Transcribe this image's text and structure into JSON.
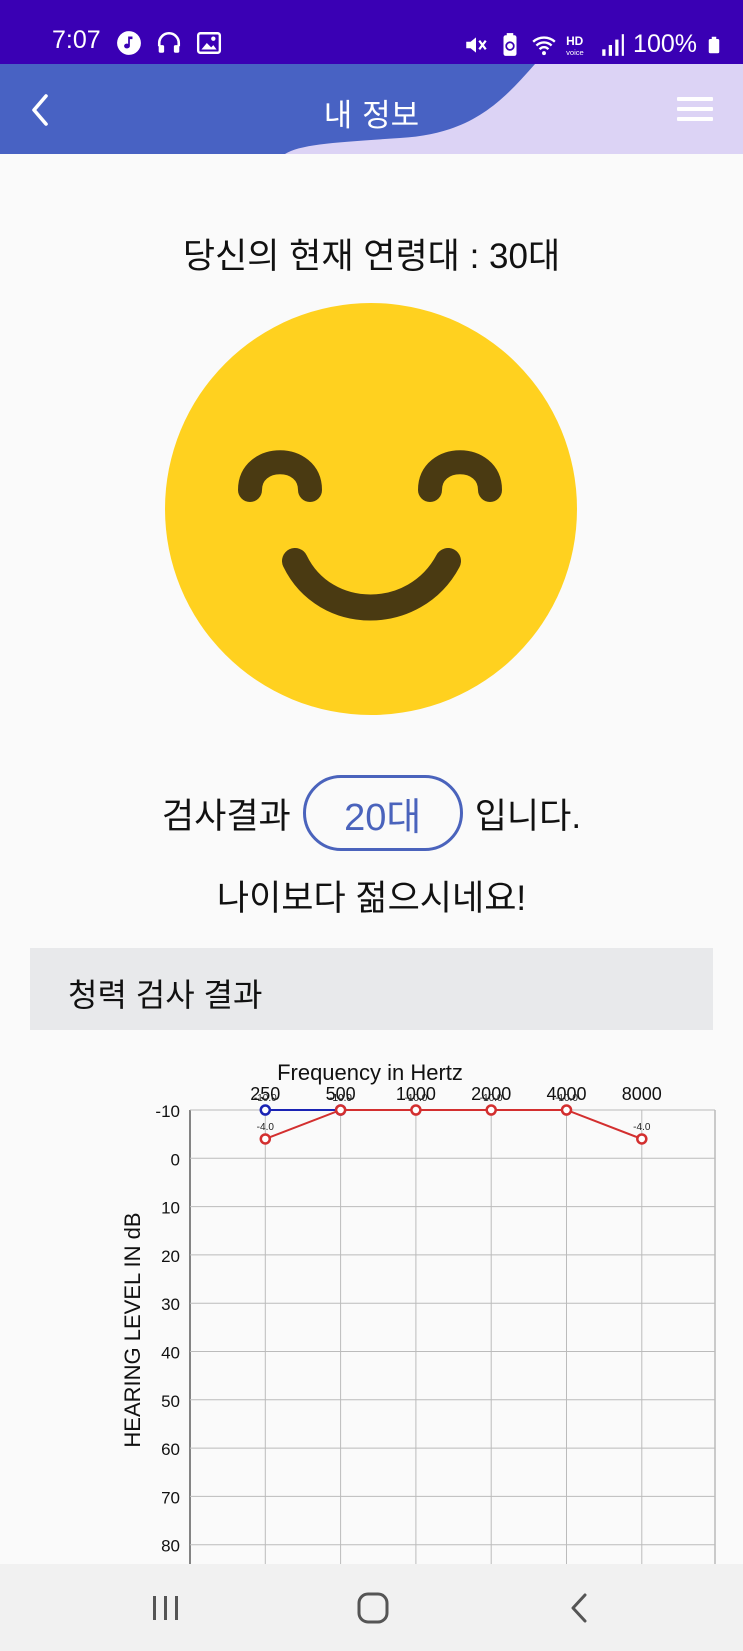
{
  "status_bar": {
    "time": "7:07",
    "battery": "100%"
  },
  "header": {
    "title": "내 정보"
  },
  "profile": {
    "age_heading": "당신의 현재 연령대 : 30대",
    "result_prefix": "검사결과",
    "result_value": "20대",
    "result_suffix": "입니다.",
    "result_message": "나이보다 젊으시네요!"
  },
  "section": {
    "title": "청력 검사 결과"
  },
  "colors": {
    "accent": "#4a63bc",
    "right_ear": "#d32f2f",
    "left_ear": "#1a23b4",
    "smiley": "#ffd11f"
  },
  "chart_data": {
    "type": "line",
    "title": "Frequency in Hertz",
    "ylabel": "HEARING LEVEL IN dB",
    "categories": [
      "250",
      "500",
      "1000",
      "2000",
      "4000",
      "8000"
    ],
    "y_ticks": [
      -10,
      0,
      10,
      20,
      30,
      40,
      50,
      60,
      70,
      80
    ],
    "ylim": [
      -10,
      80
    ],
    "y_inverted": true,
    "grid": true,
    "series": [
      {
        "color": "#1a23b4",
        "values": [
          -10.0,
          -10.0,
          null,
          null,
          null,
          null
        ],
        "labels": [
          "-10.0",
          "-10.0",
          "",
          "",
          "",
          ""
        ]
      },
      {
        "color": "#d32f2f",
        "values": [
          -4.0,
          -10.0,
          -10.0,
          -10.0,
          -10.0,
          -4.0
        ],
        "labels": [
          "-4.0",
          "-10.0",
          "-10.0",
          "-10.0",
          "-10.0",
          "-4.0"
        ]
      }
    ]
  }
}
